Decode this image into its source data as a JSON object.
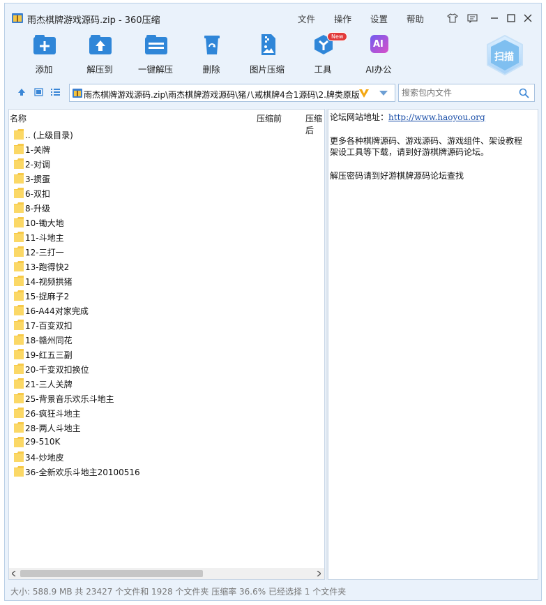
{
  "window": {
    "title": "雨杰棋牌游戏源码.zip - 360压缩"
  },
  "menu": {
    "file": "文件",
    "action": "操作",
    "settings": "设置",
    "help": "帮助"
  },
  "toolbar": {
    "add": "添加",
    "extract_to": "解压到",
    "one_click_extract": "一键解压",
    "delete": "删除",
    "image_compress": "图片压缩",
    "tools": "工具",
    "tools_badge": "New",
    "ai_office": "AI办公",
    "ai_icon_text": "AI",
    "scan": "扫描"
  },
  "colors": {
    "accent": "#2f86d8",
    "new_badge": "#e23b3b",
    "folder": "#f7c948",
    "link": "#1a4ea8"
  },
  "nav": {
    "path": "雨杰棋牌游戏源码.zip\\雨杰棋牌游戏源码\\猪八戒棋牌4合1源码\\2.牌类原版",
    "search_placeholder": "搜索包内文件"
  },
  "list": {
    "columns": {
      "name": "名称",
      "before": "压缩前",
      "after": "压缩后"
    },
    "items": [
      ".. (上级目录)",
      "1-关牌",
      "2-对调",
      "3-掼蛋",
      "6-双扣",
      "8-升级",
      "10-锄大地",
      "11-斗地主",
      "12-三打一",
      "13-跑得快2",
      "14-视频拱猪",
      "15-捉麻子2",
      "16-A44对家完成",
      "17-百变双扣",
      "18-赣州同花",
      "19-红五三副",
      "20-千变双扣换位",
      "21-三人关牌",
      "25-背景音乐欢乐斗地主",
      "26-疯狂斗地主",
      "28-两人斗地主",
      "29-510K",
      "34-炒地皮",
      "36-全新欢乐斗地主20100516"
    ]
  },
  "comment": {
    "forum_label": "论坛网站地址：",
    "forum_url": "http://www.haoyou.org",
    "line2": "更多各种棋牌源码、游戏源码、游戏组件、架设教程",
    "line3": "架设工具等下载，请到好游棋牌源码论坛。",
    "line4": "解压密码请到好游棋牌源码论坛查找"
  },
  "status": {
    "text": "大小: 588.9 MB 共 23427 个文件和 1928 个文件夹 压缩率 36.6% 已经选择 1 个文件夹"
  }
}
